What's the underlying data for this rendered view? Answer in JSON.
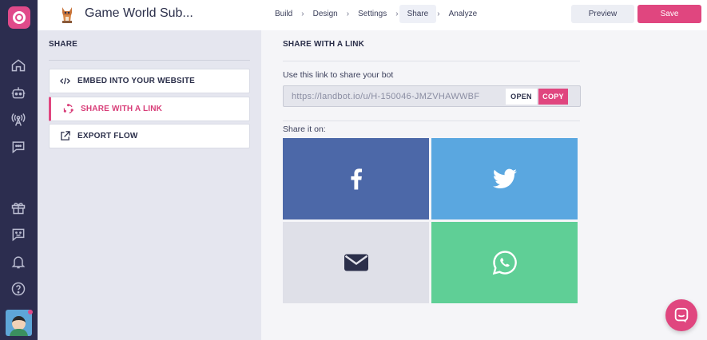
{
  "app": {
    "bot_name": "Game World Sub...",
    "steps": [
      {
        "label": "Build"
      },
      {
        "label": "Design"
      },
      {
        "label": "Settings"
      },
      {
        "label": "Share"
      },
      {
        "label": "Analyze"
      }
    ],
    "active_step": "Share",
    "preview_label": "Preview",
    "save_label": "Save",
    "accent_color": "#e0467f"
  },
  "rail": {
    "icons": [
      "logo-icon",
      "home-icon",
      "bot-icon",
      "broadcast-icon",
      "chat-icon",
      "gift-icon",
      "feedback-icon",
      "bell-icon",
      "help-icon",
      "user-avatar"
    ]
  },
  "sidebar": {
    "title": "SHARE",
    "items": [
      {
        "label": "EMBED INTO YOUR WEBSITE",
        "icon": "code-icon"
      },
      {
        "label": "SHARE WITH A LINK",
        "icon": "share-link-icon",
        "active": true
      },
      {
        "label": "EXPORT FLOW",
        "icon": "external-link-icon"
      }
    ]
  },
  "main": {
    "heading": "SHARE WITH A LINK",
    "use_label": "Use this link to share your bot",
    "url": "https://landbot.io/u/H-150046-JMZVHAWWBF",
    "open_label": "OPEN",
    "copy_label": "COPY",
    "share_on_label": "Share it on:",
    "tiles": [
      {
        "name": "facebook",
        "icon": "facebook-icon",
        "color": "#4c68a8"
      },
      {
        "name": "twitter",
        "icon": "twitter-icon",
        "color": "#5aa7e0"
      },
      {
        "name": "email",
        "icon": "email-icon",
        "color": "#dfe0e8"
      },
      {
        "name": "whatsapp",
        "icon": "whatsapp-icon",
        "color": "#5fcf96"
      }
    ]
  }
}
